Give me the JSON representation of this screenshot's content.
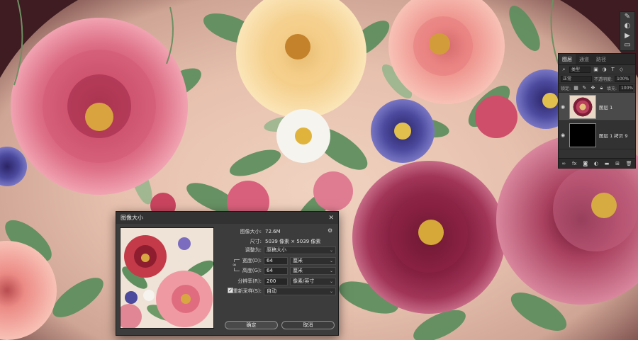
{
  "tool_strip": {
    "icons": [
      "brush-settings-icon",
      "adjust-icon",
      "play-icon",
      "comment-icon"
    ]
  },
  "layers_panel": {
    "tabs": [
      "图层",
      "通道",
      "路径"
    ],
    "kind_filter": "类型",
    "blend_mode": "正常",
    "opacity_label": "不透明度:",
    "opacity_value": "100%",
    "lock_label": "锁定:",
    "fill_label": "填充:",
    "fill_value": "100%",
    "layers": [
      {
        "name": "图层 1",
        "visible": true,
        "selected": true
      },
      {
        "name": "图层 1 拷贝 9",
        "visible": true,
        "selected": false
      }
    ]
  },
  "dialog": {
    "title": "图像大小",
    "image_size_label": "图像大小:",
    "image_size_value": "72.6M",
    "dimensions_label": "尺寸:",
    "dimensions_value": "5039 像素 × 5039 像素",
    "fit_to_label": "调整为:",
    "fit_to_value": "原稿大小",
    "width_label": "宽度(D):",
    "width_value": "64",
    "width_unit": "厘米",
    "height_label": "高度(G):",
    "height_value": "64",
    "height_unit": "厘米",
    "resolution_label": "分辨率(R):",
    "resolution_value": "200",
    "resolution_unit": "像素/英寸",
    "resample_label": "重新采样(S):",
    "resample_checked": true,
    "resample_value": "自动",
    "ok_label": "确定",
    "cancel_label": "取消"
  }
}
